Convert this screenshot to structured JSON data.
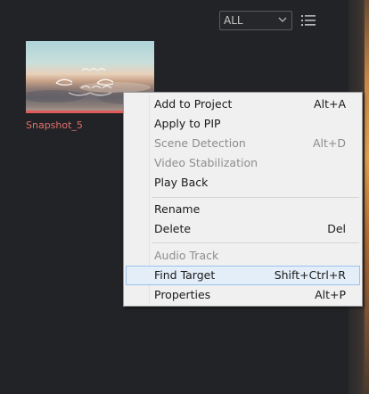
{
  "toolbar": {
    "filter_value": "ALL",
    "filter_icon": "chevron-down-icon",
    "view_toggle_icon": "list-view-icon"
  },
  "media": {
    "items": [
      {
        "name": "Snapshot_5"
      }
    ]
  },
  "context_menu": {
    "items": [
      {
        "label": "Add to Project",
        "shortcut": "Alt+A",
        "enabled": true
      },
      {
        "label": "Apply to PIP",
        "shortcut": "",
        "enabled": true
      },
      {
        "label": "Scene Detection",
        "shortcut": "Alt+D",
        "enabled": false
      },
      {
        "label": "Video Stabilization",
        "shortcut": "",
        "enabled": false
      },
      {
        "label": "Play Back",
        "shortcut": "",
        "enabled": true
      },
      {
        "label": "Rename",
        "shortcut": "",
        "enabled": true
      },
      {
        "label": "Delete",
        "shortcut": "Del",
        "enabled": true
      },
      {
        "label": "Audio Track",
        "shortcut": "",
        "enabled": false
      },
      {
        "label": "Find Target",
        "shortcut": "Shift+Ctrl+R",
        "enabled": true,
        "highlighted": true
      },
      {
        "label": "Properties",
        "shortcut": "Alt+P",
        "enabled": true
      }
    ]
  },
  "colors": {
    "background": "#222326",
    "caption_accent": "#e26f6a",
    "menu_background": "#f0f0f0",
    "menu_highlight": "#e4eef9",
    "disabled_text": "#8d8d8d"
  }
}
